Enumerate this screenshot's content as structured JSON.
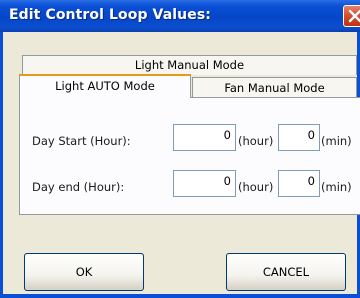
{
  "window": {
    "title": "Edit Control Loop Values:"
  },
  "tabs": {
    "light_manual": "Light Manual Mode",
    "light_auto": "Light AUTO Mode",
    "fan_manual": "Fan Manual Mode"
  },
  "form": {
    "day_start_label": "Day Start (Hour):",
    "day_start_hour": "0",
    "day_start_min": "0",
    "day_end_label": "Day end (Hour):",
    "day_end_hour": "0",
    "day_end_min": "0",
    "hour_unit": "(hour)",
    "min_unit": "(min)"
  },
  "buttons": {
    "ok": "OK",
    "cancel": "CANCEL"
  },
  "colors": {
    "titlebar": "#0a4fd6",
    "dialog_bg": "#ece9d8",
    "tab_highlight": "#e69a1c",
    "close": "#d34d2e"
  },
  "icons": {
    "close": "close-icon"
  }
}
